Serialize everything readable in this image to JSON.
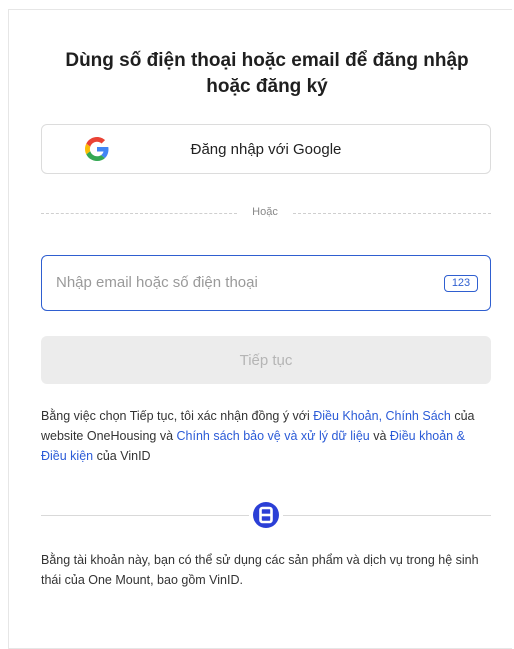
{
  "title": "Dùng số điện thoại hoặc email để đăng nhập hoặc đăng ký",
  "google_button": {
    "label": "Đăng nhập với Google",
    "icon": "google-icon"
  },
  "divider_text": "Hoặc",
  "input": {
    "placeholder": "Nhập email hoặc số điện thoại",
    "value": "",
    "badge": "123",
    "badge_icon": "numeric-keyboard-icon"
  },
  "continue_button": {
    "label": "Tiếp tục",
    "state": "disabled"
  },
  "terms": {
    "prefix": "Bằng việc chọn Tiếp tục, tôi xác nhận đồng ý với ",
    "link1": "Điều Khoản, Chính Sách",
    "mid1": " của website OneHousing và ",
    "link2": "Chính sách bảo vệ và xử lý dữ liệu",
    "mid2": " và ",
    "link3": "Điều khoản & Điều kiện",
    "suffix": " của VinID"
  },
  "brand_icon": "one-mount-logo-icon",
  "footer_note": "Bằng tài khoản này, bạn có thể sử dụng các sản phẩm và dịch vụ trong hệ sinh thái của One Mount, bao gồm VinID.",
  "colors": {
    "accent": "#2b5bd7",
    "input_border": "#2f5fd0",
    "disabled_bg": "#ececec",
    "disabled_text": "#b5b5b5"
  }
}
